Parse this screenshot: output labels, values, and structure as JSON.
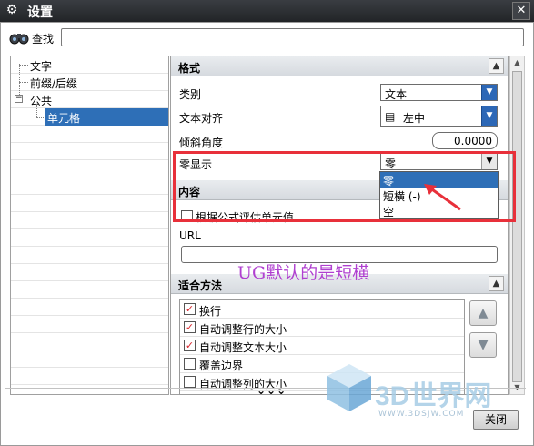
{
  "window": {
    "title": "设置",
    "close_glyph": "✕"
  },
  "search": {
    "label": "查找",
    "value": ""
  },
  "tree": {
    "items": [
      {
        "label": "文字"
      },
      {
        "label": "前缀/后缀"
      },
      {
        "label": "公共",
        "expander": "−"
      },
      {
        "label": "单元格",
        "selected": true
      }
    ]
  },
  "format_section": {
    "title": "格式",
    "type_label": "类别",
    "type_value": "文本",
    "align_label": "文本对齐",
    "align_icon": "▤",
    "align_value": "左中",
    "angle_label": "倾斜角度",
    "angle_value": "0.0000",
    "zero_label": "零显示",
    "zero_value": "零",
    "zero_options": [
      "零",
      "短横 (-)",
      "空"
    ]
  },
  "content_section": {
    "title": "内容",
    "formula_label": "根据公式评估单元值",
    "url_label": "URL",
    "url_value": ""
  },
  "annotation": "UG默认的是短横",
  "fit_section": {
    "title": "适合方法",
    "items": [
      {
        "label": "换行",
        "checked": true
      },
      {
        "label": "自动调整行的大小",
        "checked": true
      },
      {
        "label": "自动调整文本大小",
        "checked": true
      },
      {
        "label": "覆盖边界",
        "checked": false
      },
      {
        "label": "自动调整列的大小",
        "checked": false
      }
    ]
  },
  "footer": {
    "expand_glyph": "⌄⌄⌄",
    "close_label": "关闭"
  },
  "watermark": {
    "text": "3D世界网",
    "url": "WWW.3DSJW.COM"
  },
  "colors": {
    "accent": "#2e6fb7",
    "highlight_border": "#e8303a",
    "annotation": "#b040d0"
  }
}
